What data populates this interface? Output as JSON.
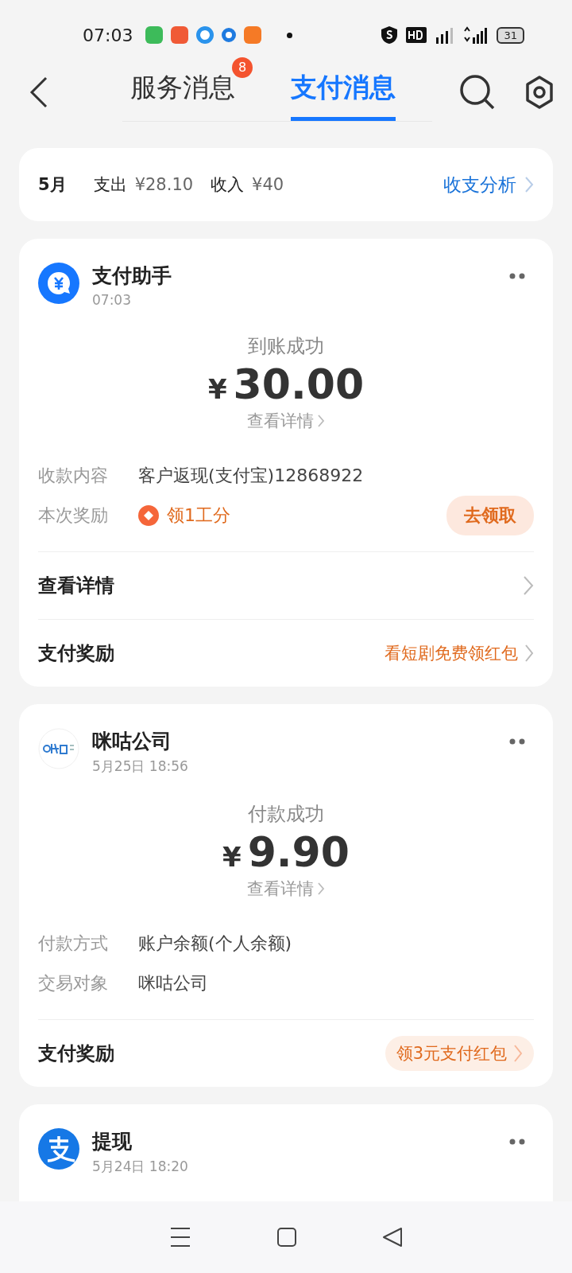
{
  "status_bar": {
    "time": "07:03",
    "battery": "31"
  },
  "tabs": [
    {
      "label": "服务消息",
      "badge": "8",
      "selected": false
    },
    {
      "label": "支付消息",
      "selected": true
    }
  ],
  "summary": {
    "month": "5月",
    "expense_label": "支出",
    "expense": "¥28.10",
    "income_label": "收入",
    "income": "¥40",
    "link": "收支分析"
  },
  "messages": [
    {
      "sender": "支付助手",
      "time": "07:03",
      "avatar": {
        "kind": "yuan"
      },
      "status": "到账成功",
      "currency": "¥",
      "amount": "30.00",
      "detail_link": "查看详情",
      "fields": [
        {
          "kind": "text",
          "label": "收款内容",
          "value": "客户返现(支付宝)12868922"
        },
        {
          "kind": "reward",
          "label": "本次奖励",
          "value": "领1工分",
          "action": "去领取"
        }
      ],
      "rows": [
        {
          "kind": "link",
          "label": "查看详情"
        },
        {
          "kind": "promo",
          "label": "支付奖励",
          "value": "看短剧免费领红包",
          "pill": false
        }
      ]
    },
    {
      "sender": "咪咕公司",
      "time": "5月25日 18:56",
      "avatar": {
        "kind": "migu"
      },
      "status": "付款成功",
      "currency": "¥",
      "amount": "9.90",
      "detail_link": "查看详情",
      "fields": [
        {
          "kind": "text",
          "label": "付款方式",
          "value": "账户余额(个人余额)"
        },
        {
          "kind": "text",
          "label": "交易对象",
          "value": "咪咕公司"
        }
      ],
      "rows": [
        {
          "kind": "promo",
          "label": "支付奖励",
          "value": "领3元支付红包",
          "pill": true
        }
      ]
    },
    {
      "sender": "提现",
      "time": "5月24日 18:20",
      "avatar": {
        "kind": "alipay"
      }
    }
  ]
}
